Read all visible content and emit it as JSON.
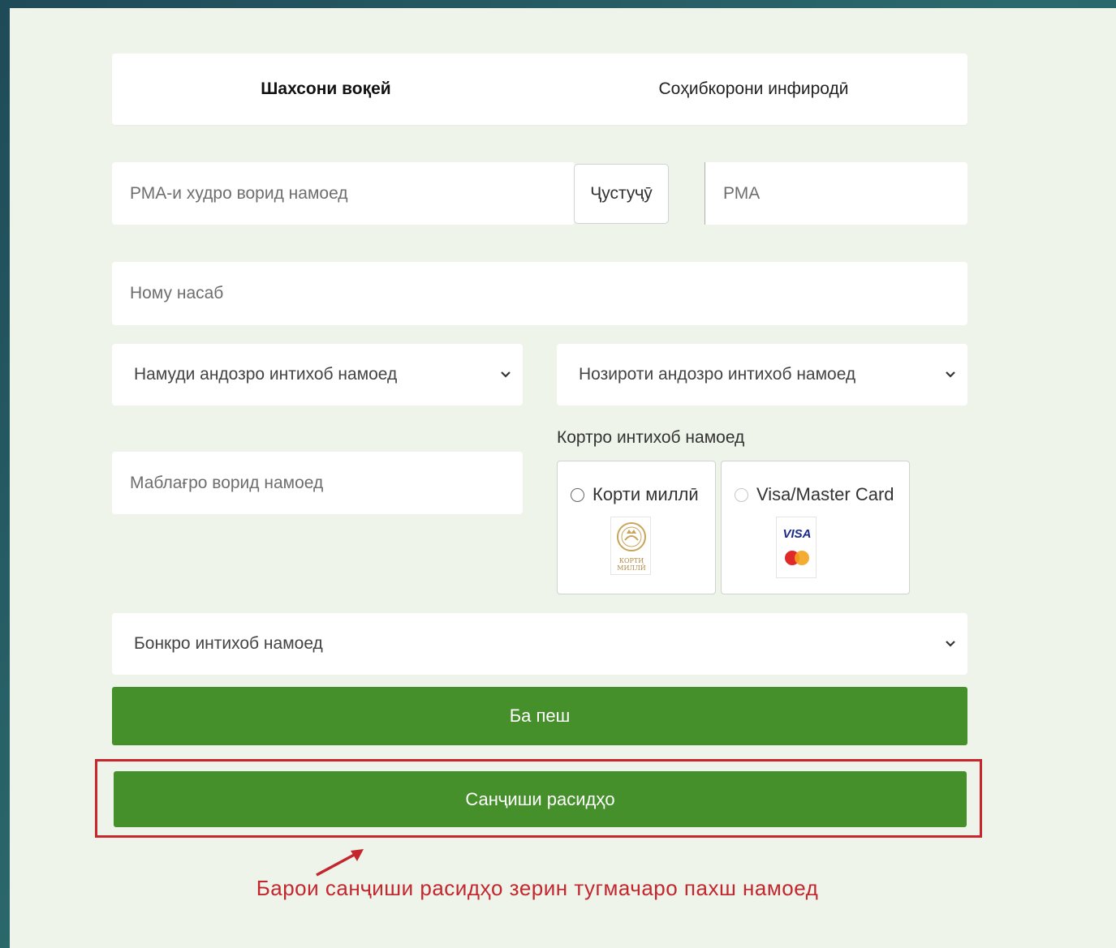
{
  "tabs": [
    "Шахсони воқей",
    "Соҳибкорони инфиродӣ"
  ],
  "fields": {
    "rma_own_placeholder": "РМА-и худро ворид намоед",
    "search_button": "Ҷустуҷӯ",
    "rma_placeholder": "РМА",
    "name_placeholder": "Ному насаб",
    "tax_type_select": "Намуди андозро интихоб намоед",
    "tax_office_select": "Нозироти андозро интихоб намоед",
    "amount_placeholder": "Маблағро ворид намоед",
    "bank_select": "Бонкро интихоб намоед"
  },
  "card": {
    "label": "Кортро интихоб намоед",
    "options": [
      "Корти миллӣ",
      "Visa/Master Card"
    ],
    "national_logo_text": [
      "КОРТИ",
      "МИЛЛӢ"
    ],
    "visa_logo_text": "VISA"
  },
  "buttons": {
    "next": "Ба пеш",
    "check_costs": "Санҷиши расидҳо"
  },
  "annotation": "Барои санҷиши расидҳо зерин тугмачаро пахш намоед",
  "colors": {
    "button_green": "#45902a",
    "highlight_red": "#c8252d",
    "page_bg": "#eef4ea"
  }
}
